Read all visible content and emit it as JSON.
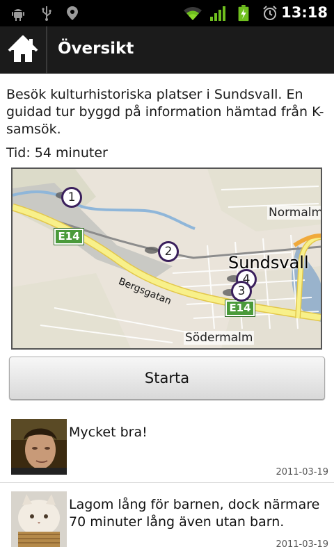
{
  "status_bar": {
    "time": "13:18",
    "left_icons": [
      "android-debug-icon",
      "usb-icon",
      "location-icon"
    ],
    "right_icons": [
      "wifi-icon",
      "signal-icon",
      "battery-charging-icon",
      "alarm-icon"
    ]
  },
  "action_bar": {
    "title": "Översikt",
    "home_icon": "home-icon"
  },
  "tour": {
    "description": "Besök kulturhistoriska platser i Sundsvall. En guidad tur byggd på information hämtad från K-samsök.",
    "duration": "Tid: 54 minuter"
  },
  "map": {
    "labels": {
      "normalm": "Normalm",
      "city": "Sundsvall",
      "street": "Bergsgatan",
      "sodermalm": "Södermalm",
      "road_1": "E14",
      "road_2": "E14"
    },
    "markers": [
      "1",
      "2",
      "3",
      "4"
    ]
  },
  "start_button": {
    "label": "Starta"
  },
  "comments": [
    {
      "text": "Mycket bra!",
      "date": "2011-03-19"
    },
    {
      "text": "Lagom lång för barnen, dock närmare 70 minuter lång även utan barn.",
      "date": "2011-03-19"
    }
  ],
  "colors": {
    "status_bar": "#000000",
    "action_bar": "#1b1b1b",
    "marker": "#3a1f5c",
    "road_sign": "#4a9a3a",
    "highway": "#f8f08a"
  }
}
